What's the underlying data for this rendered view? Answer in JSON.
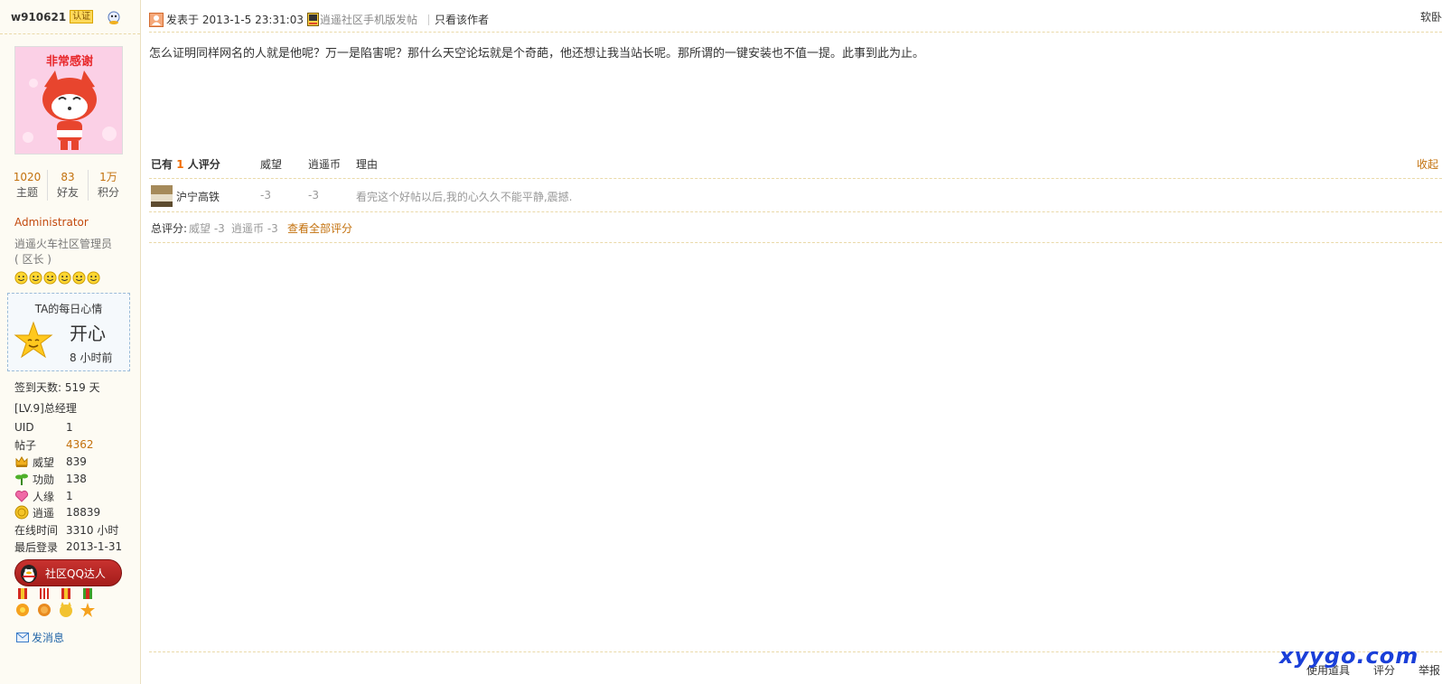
{
  "author": {
    "name": "w910621",
    "verify_badge": "认证",
    "stats": [
      {
        "value": "1020",
        "label": "主题"
      },
      {
        "value": "83",
        "label": "好友"
      },
      {
        "value": "1万",
        "label": "积分"
      }
    ],
    "avatar_caption": "非常感谢",
    "group": "Administrator",
    "title_line1": "逍遥火车社区管理员",
    "title_line2": "( 区长 )",
    "mood": {
      "title": "TA的每日心情",
      "value": "开心",
      "time": "8 小时前"
    },
    "signin": "签到天数: 519 天",
    "level": "[LV.9]总经理",
    "info": [
      {
        "key": "UID",
        "value": "1",
        "icon": "",
        "orange": false
      },
      {
        "key": "帖子",
        "value": "4362",
        "icon": "",
        "orange": true
      },
      {
        "key": "威望",
        "value": "839",
        "icon": "crown-icon",
        "orange": false
      },
      {
        "key": "功勋",
        "value": "138",
        "icon": "sprout-icon",
        "orange": false
      },
      {
        "key": "人缘",
        "value": "1",
        "icon": "heart-icon",
        "orange": false
      },
      {
        "key": "逍遥",
        "value": "18839",
        "icon": "coin-icon",
        "orange": false
      },
      {
        "key": "在线时间",
        "value": "3310 小时",
        "icon": "",
        "orange": false
      },
      {
        "key": "最后登录",
        "value": "2013-1-31",
        "icon": "",
        "orange": false
      }
    ],
    "qq_badge": "社区QQ达人",
    "send_message": "发消息"
  },
  "post": {
    "posted_at": "发表于 2013-1-5 23:31:03",
    "mobile_link": "逍遥社区手机版发帖",
    "only_author": "只看该作者",
    "soft_link": "软卧",
    "content": "怎么证明同样网名的人就是他呢？万一是陷害呢？那什么天空论坛就是个奇葩，他还想让我当站长呢。那所谓的一键安装也不值一提。此事到此为止。"
  },
  "rating": {
    "prefix": "已有",
    "count": "1",
    "suffix": "人评分",
    "col_prestige": "威望",
    "col_coin": "逍遥币",
    "col_reason": "理由",
    "collapse": "收起",
    "rows": [
      {
        "rater": "沪宁高铁",
        "prestige": "-3",
        "coin": "-3",
        "reason": "看完这个好帖以后,我的心久久不能平静,震撼."
      }
    ],
    "total_label": "总评分:",
    "total_prestige": "威望 -3",
    "total_coin": "逍遥币 -3",
    "view_all": "查看全部评分"
  },
  "footer": {
    "use_tool": "使用道具",
    "rate": "评分",
    "report": "举报"
  },
  "watermark": "xyygo.com"
}
